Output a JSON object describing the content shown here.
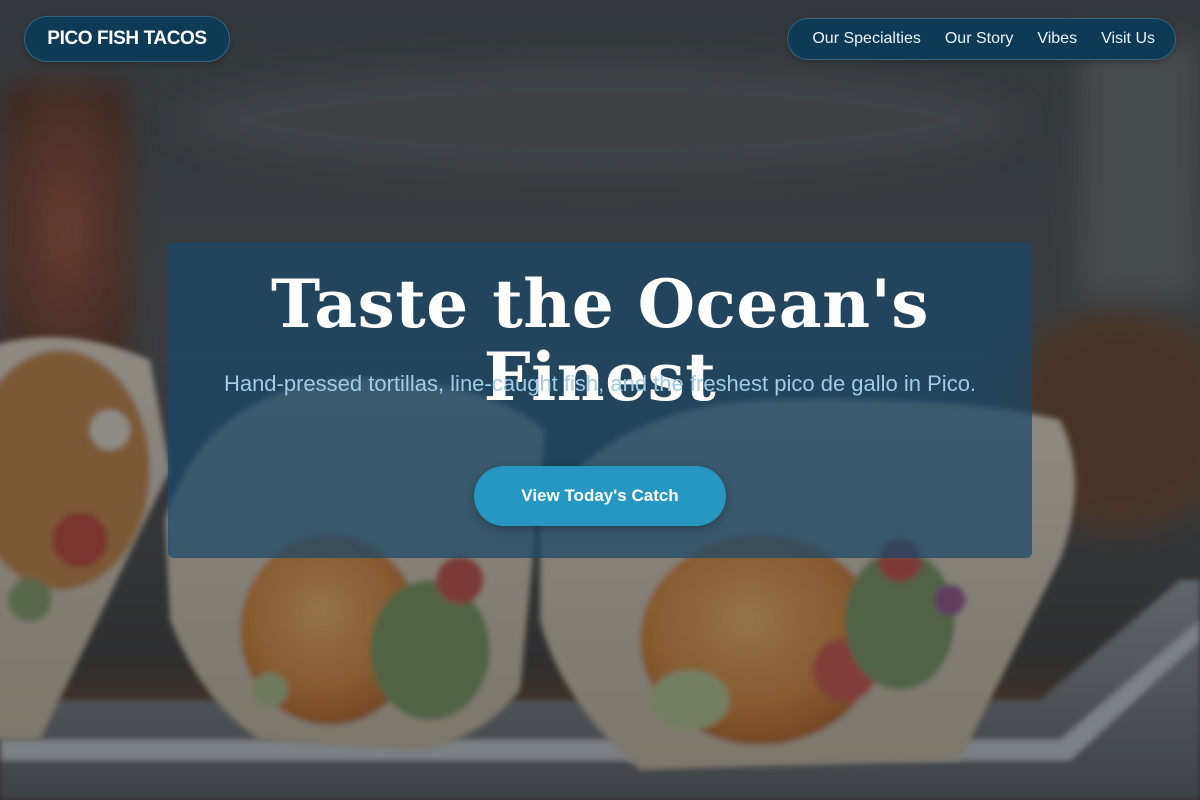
{
  "header": {
    "brand": "PICO FISH TACOS",
    "nav": [
      {
        "label": "Our Specialties"
      },
      {
        "label": "Our Story"
      },
      {
        "label": "Vibes"
      },
      {
        "label": "Visit Us"
      }
    ]
  },
  "hero": {
    "title": "Taste the Ocean's Finest",
    "subtitle": "Hand-pressed tortillas, line-caught fish, and the freshest pico de gallo in Pico.",
    "cta_label": "View Today's Catch",
    "background_image": "fish-tacos-photo"
  },
  "colors": {
    "brand_navy": "#0f3a56",
    "card_blue": "#1b4868",
    "accent_teal": "#2597c0",
    "subtitle_blue": "#9fcce6"
  }
}
